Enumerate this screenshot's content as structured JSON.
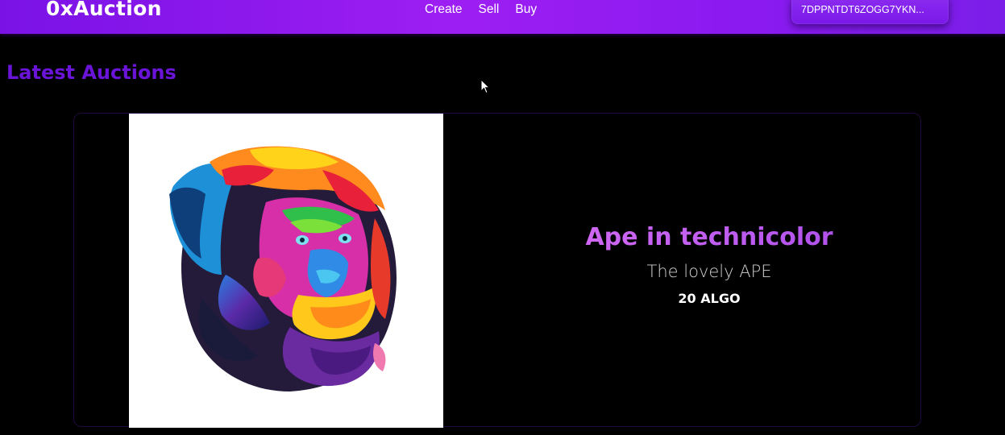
{
  "navbar": {
    "brand": "0xAuction",
    "links": [
      "Create",
      "Sell",
      "Buy"
    ],
    "wallet_address": "7DPPNTDT6ZOGG7YKN..."
  },
  "main": {
    "section_title": "Latest Auctions",
    "auction": {
      "title": "Ape in technicolor",
      "description": "The lovely APE",
      "price": "20 ALGO",
      "image": "colorful-ape-portrait"
    }
  },
  "colors": {
    "navbar": "#8a1af0",
    "accent": "#6a14d8",
    "title_gradient_start": "#d66cf3",
    "title_gradient_end": "#a84be8"
  },
  "icons": [
    "mouse-pointer-icon"
  ]
}
